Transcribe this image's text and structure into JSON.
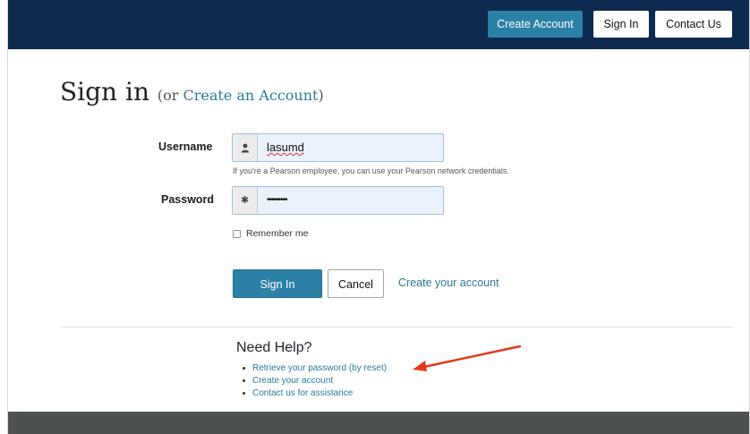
{
  "header": {
    "create_account": "Create Account",
    "sign_in": "Sign In",
    "contact_us": "Contact Us"
  },
  "title": {
    "main": "Sign in",
    "open": "(or ",
    "link": "Create an Account",
    "close": ")"
  },
  "form": {
    "username_label": "Username",
    "username_value": "lasumd",
    "username_hint": "If you're a Pearson employee, you can use your Pearson network credentials.",
    "password_label": "Password",
    "password_value": "•••••••••",
    "remember_label": "Remember me",
    "sign_in_button": "Sign In",
    "cancel_button": "Cancel",
    "create_link": "Create your account"
  },
  "help": {
    "title": "Need Help?",
    "items": [
      "Retrieve your password (by reset)",
      "Create your account",
      "Contact us for assistance"
    ]
  },
  "colors": {
    "topbar": "#0e2a4f",
    "accent": "#2b80a6",
    "link": "#2b7a9b",
    "annotation_arrow": "#e03a1f",
    "footer": "#4d5151"
  },
  "icons": {
    "username_addon": "user-icon",
    "password_addon": "asterisk-icon"
  }
}
